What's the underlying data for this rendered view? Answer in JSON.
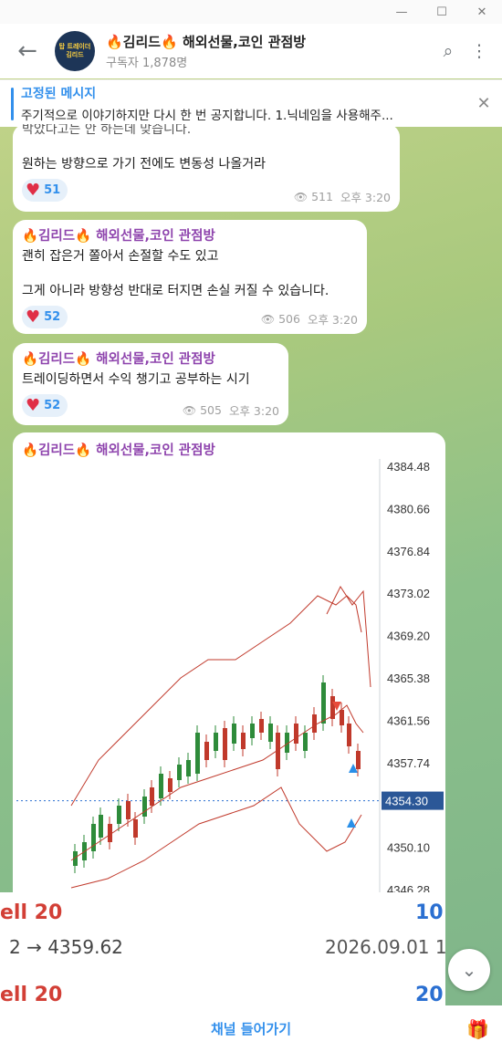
{
  "window": {
    "controls": [
      "—",
      "☐",
      "✕"
    ]
  },
  "header": {
    "back_icon": "←",
    "avatar_text": "탑 트레이더\n김리드",
    "title": "🔥김리드🔥 해외선물,코인 관점방",
    "subscribers": "구독자 1,878명",
    "search_icon": "⌕",
    "more_icon": "⋮"
  },
  "pinned": {
    "title": "고정된 메시지",
    "text": "주기적으로 이야기하지만 다시 한 번 공지합니다. 1.닉네임을 사용해주...",
    "close_icon": "✕"
  },
  "messages": [
    {
      "sender": "",
      "lines": [
        "박았다고는 안 하는데 맞습니다.",
        "",
        "원하는 방향으로 가기 전에도 변동성 나올거라"
      ],
      "reactions": "51",
      "views": "511",
      "time": "오후 3:20"
    },
    {
      "sender": "🔥김리드🔥 해외선물,코인 관점방",
      "lines": [
        "괜히 잡은거 쫄아서 손절할 수도 있고",
        "",
        "그게 아니라 방향성 반대로 터지면 손실 커질 수 있습니다."
      ],
      "reactions": "52",
      "views": "506",
      "time": "오후 3:20"
    },
    {
      "sender": "🔥김리드🔥 해외선물,코인 관점방",
      "lines": [
        "트레이딩하면서 수익 챙기고 공부하는 시기"
      ],
      "reactions": "52",
      "views": "505",
      "time": "오후 3:20"
    },
    {
      "sender": "🔥김리드🔥 해외선물,코인 관점방"
    }
  ],
  "chart_data": {
    "type": "line",
    "y_ticks": [
      "4384.48",
      "4380.66",
      "4376.84",
      "4373.02",
      "4369.20",
      "4365.38",
      "4361.56",
      "4357.74",
      "4354.30",
      "4350.10",
      "4346.28"
    ],
    "current_price": "4354.30",
    "ylim": [
      4346.28,
      4384.48
    ]
  },
  "bottom_strip": {
    "row1_left": "ell 20",
    "row1_right": "10",
    "row2_left": "2 → 4359.62",
    "row2_right": "2026.09.01 1",
    "row3_left": "ell 20",
    "row3_right": "20"
  },
  "channel_bar": {
    "button": "채널 들어가기",
    "gift_icon": "🎁"
  },
  "scroll_down_icon": "⌄"
}
